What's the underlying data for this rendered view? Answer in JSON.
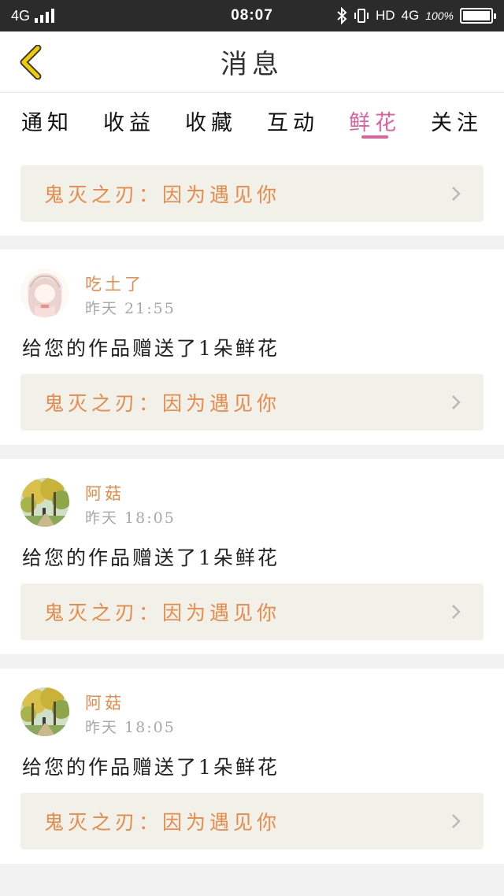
{
  "status_bar": {
    "network_left": "4G",
    "time": "08:07",
    "hd": "HD",
    "network_right": "4G",
    "battery": "100%"
  },
  "header": {
    "title": "消息",
    "back_icon": "chevron-left-icon",
    "back_color": "#e8c100"
  },
  "tabs": [
    {
      "label": "通知",
      "active": false
    },
    {
      "label": "收益",
      "active": false
    },
    {
      "label": "收藏",
      "active": false
    },
    {
      "label": "互动",
      "active": false
    },
    {
      "label": "鲜花",
      "active": true
    },
    {
      "label": "关注",
      "active": false
    }
  ],
  "colors": {
    "accent": "#e0609a",
    "username": "#e88a4a",
    "work_title": "#e88a4a",
    "time": "#a8a8a8"
  },
  "partial_card": {
    "work_title": "鬼灭之刃：因为遇见你"
  },
  "messages": [
    {
      "username": "吃土了",
      "time": "昨天 21:55",
      "text": "给您的作品赠送了1朵鲜花",
      "work_title": "鬼灭之刃：因为遇见你",
      "avatar": "anime-girl-avatar"
    },
    {
      "username": "阿菇",
      "time": "昨天 18:05",
      "text": "给您的作品赠送了1朵鲜花",
      "work_title": "鬼灭之刃：因为遇见你",
      "avatar": "autumn-tree-avatar"
    },
    {
      "username": "阿菇",
      "time": "昨天 18:05",
      "text": "给您的作品赠送了1朵鲜花",
      "work_title": "鬼灭之刃：因为遇见你",
      "avatar": "autumn-tree-avatar"
    }
  ]
}
